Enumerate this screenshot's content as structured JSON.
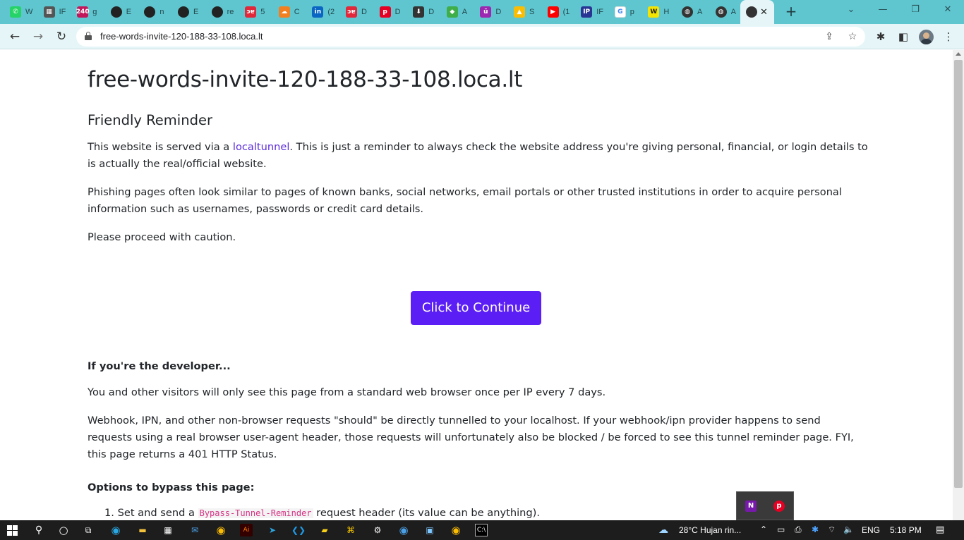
{
  "browser": {
    "tabs": [
      {
        "label": "W",
        "icon": "whatsapp-icon",
        "color": "#25d366",
        "glyph": "✆"
      },
      {
        "label": "IF",
        "icon": "calculator-icon",
        "color": "#555555",
        "glyph": "▦"
      },
      {
        "label": "g",
        "icon": "counter-badge-icon",
        "color": "#c2185b",
        "glyph": "240"
      },
      {
        "label": "E",
        "icon": "github-icon",
        "color": "#222222",
        "glyph": ""
      },
      {
        "label": "n",
        "icon": "github-icon",
        "color": "#222222",
        "glyph": ""
      },
      {
        "label": "E",
        "icon": "github-icon",
        "color": "#222222",
        "glyph": ""
      },
      {
        "label": "re",
        "icon": "github-icon",
        "color": "#222222",
        "glyph": ""
      },
      {
        "label": "5",
        "icon": "dev-red-icon",
        "color": "#e0283a",
        "glyph": "ɔɐ"
      },
      {
        "label": "C",
        "icon": "cloudflare-icon",
        "color": "#f38020",
        "glyph": "☁"
      },
      {
        "label": "(2",
        "icon": "linkedin-icon",
        "color": "#0a66c2",
        "glyph": "in"
      },
      {
        "label": "D",
        "icon": "dev-red-icon",
        "color": "#e0283a",
        "glyph": "ɔɐ"
      },
      {
        "label": "D",
        "icon": "pinterest-icon",
        "color": "#e60023",
        "glyph": "p"
      },
      {
        "label": "D",
        "icon": "download-icon",
        "color": "#333333",
        "glyph": "⬇"
      },
      {
        "label": "A",
        "icon": "colorful-app-icon",
        "color": "#3fae49",
        "glyph": "◆"
      },
      {
        "label": "D",
        "icon": "u-circle-icon",
        "color": "#9c27b0",
        "glyph": "ü"
      },
      {
        "label": "S",
        "icon": "drive-icon",
        "color": "#fbbc04",
        "glyph": "▲"
      },
      {
        "label": "(1",
        "icon": "youtube-icon",
        "color": "#ff0000",
        "glyph": "▶"
      },
      {
        "label": "IF",
        "icon": "ip-icon",
        "color": "#283593",
        "glyph": "IP"
      },
      {
        "label": "p",
        "icon": "google-icon",
        "color": "#ffffff",
        "glyph": "G"
      },
      {
        "label": "H",
        "icon": "w-yellow-icon",
        "color": "#f5e400",
        "glyph": "W"
      },
      {
        "label": "A",
        "icon": "globe-icon",
        "color": "#333333",
        "glyph": "◍"
      },
      {
        "label": "A",
        "icon": "globe-icon",
        "color": "#333333",
        "glyph": "◍"
      }
    ],
    "active_tab_close": "✕",
    "new_tab": "+",
    "window_controls": {
      "dropdown": "⌄",
      "minimize": "—",
      "restore": "❐",
      "close": "✕"
    },
    "nav": {
      "back": "←",
      "forward": "→",
      "reload": "↻"
    },
    "url": "free-words-invite-120-188-33-108.loca.lt",
    "omnibox_icons": {
      "share": "⇪",
      "bookmark": "☆"
    },
    "toolbar_icons": {
      "extensions": "✱",
      "sidepanel": "◧",
      "menu": "⋮"
    }
  },
  "page": {
    "title": "free-words-invite-120-188-33-108.loca.lt",
    "subheading": "Friendly Reminder",
    "para1_before": "This website is served via a ",
    "para1_link": "localtunnel",
    "para1_after": ". This is just a reminder to always check the website address you're giving personal, financial, or login details to is actually the real/official website.",
    "para2": "Phishing pages often look similar to pages of known banks, social networks, email portals or other trusted institutions in order to acquire personal information such as usernames, passwords or credit card details.",
    "para3": "Please proceed with caution.",
    "continue_button": "Click to Continue",
    "developer_heading": "If you're the developer...",
    "dev_para1": "You and other visitors will only see this page from a standard web browser once per IP every 7 days.",
    "dev_para2": "Webhook, IPN, and other non-browser requests \"should\" be directly tunnelled to your localhost. If your webhook/ipn provider happens to send requests using a real browser user-agent header, those requests will unfortunately also be blocked / be forced to see this tunnel reminder page. FYI, this page returns a 401 HTTP Status.",
    "options_heading": "Options to bypass this page:",
    "option1_num": "1.",
    "option1_before": "Set and send a ",
    "option1_code": "Bypass-Tunnel-Reminder",
    "option1_after": " request header (its value can be anything)."
  },
  "popup": {
    "onenote": "N",
    "pinterest": "p"
  },
  "taskbar": {
    "weather": "28°C  Hujan rin...",
    "language": "ENG",
    "time": "5:18 PM"
  },
  "colors": {
    "tabstrip": "#5fc6d0",
    "toolbar": "#e6f6f8",
    "link": "#5b2bdc",
    "button": "#5b1ef5",
    "taskbar": "#1d1d1d"
  }
}
